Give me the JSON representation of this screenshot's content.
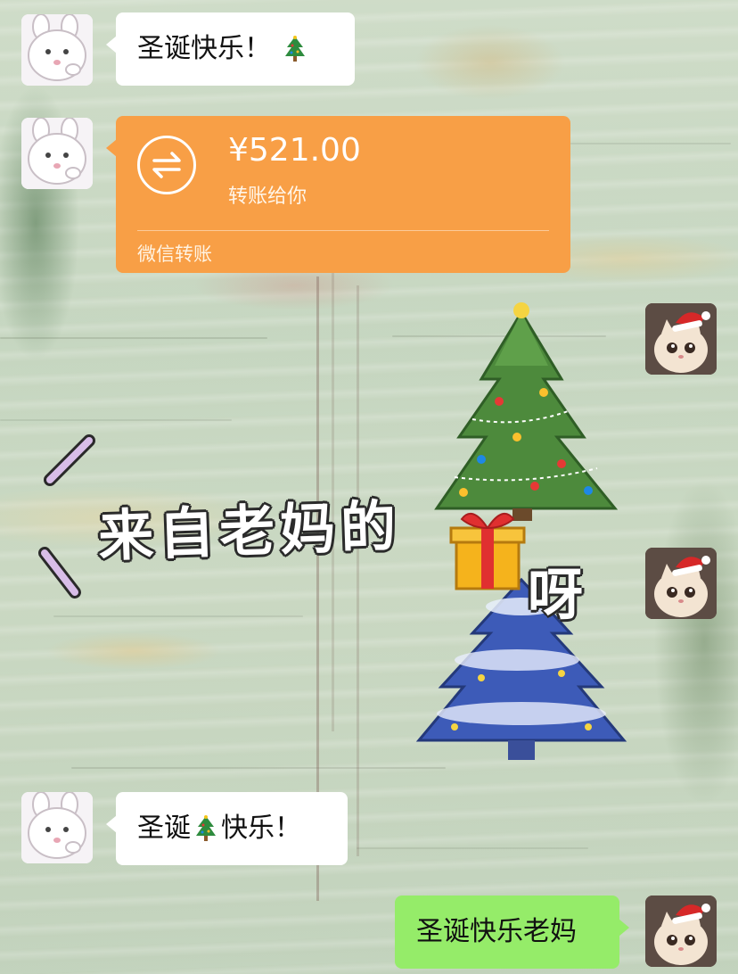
{
  "messages": [
    {
      "id": "m1",
      "side": "left",
      "sender": "bunny",
      "text": "圣诞快乐！",
      "suffix_icon": "christmas-tree-emoji"
    },
    {
      "id": "m2",
      "side": "left",
      "sender": "bunny",
      "type": "transfer",
      "transfer": {
        "amount": "¥521.00",
        "description": "转账给你",
        "footer": "微信转账"
      }
    },
    {
      "id": "m3",
      "side": "right",
      "sender": "cat-santa-hat",
      "type": "sticker",
      "sticker": {
        "text_main": "来自老妈的",
        "text_end": "呀",
        "icons": [
          "green-christmas-tree",
          "gift-box",
          "blue-christmas-tree"
        ]
      }
    },
    {
      "id": "m4",
      "side": "left",
      "sender": "bunny",
      "text_before": "圣诞",
      "text_after": "快乐！",
      "inline_icon": "christmas-tree-emoji"
    },
    {
      "id": "m5",
      "side": "right",
      "sender": "cat-santa-hat",
      "text": "圣诞快乐老妈"
    }
  ],
  "colors": {
    "transfer_bg": "#f89f46",
    "outgoing_bubble": "#95ec69",
    "incoming_bubble": "#ffffff"
  }
}
